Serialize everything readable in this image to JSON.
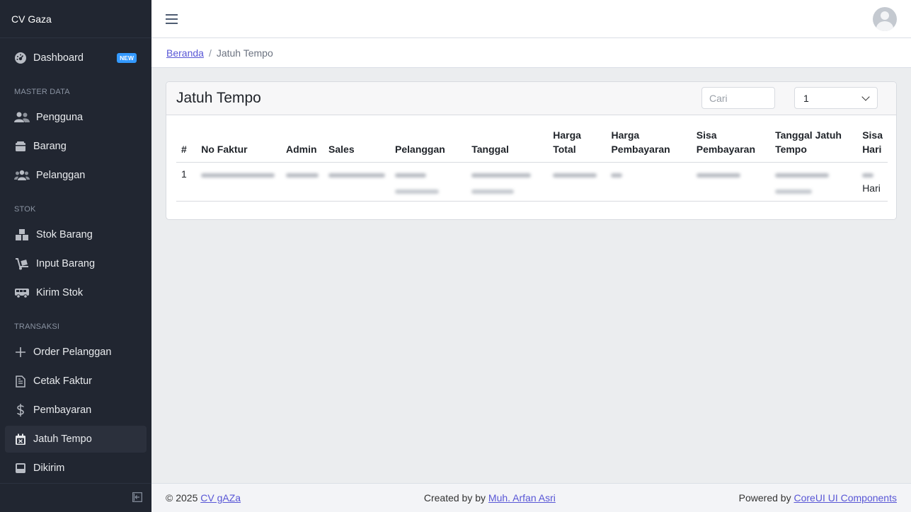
{
  "brand": "CV Gaza",
  "sidebar": {
    "dashboard": {
      "label": "Dashboard",
      "badge": "NEW"
    },
    "sections": {
      "master": "MASTER DATA",
      "stok": "STOK",
      "transaksi": "TRANSAKSI"
    },
    "items": {
      "pengguna": "Pengguna",
      "barang": "Barang",
      "pelanggan": "Pelanggan",
      "stok_barang": "Stok Barang",
      "input_barang": "Input Barang",
      "kirim_stok": "Kirim Stok",
      "order_pelanggan": "Order Pelanggan",
      "cetak_faktur": "Cetak Faktur",
      "pembayaran": "Pembayaran",
      "jatuh_tempo": "Jatuh Tempo",
      "dikirim": "Dikirim"
    }
  },
  "breadcrumb": {
    "home": "Beranda",
    "sep": "/",
    "current": "Jatuh Tempo"
  },
  "card": {
    "title": "Jatuh Tempo",
    "search_placeholder": "Cari",
    "select_value": "1"
  },
  "table": {
    "headers": {
      "num": "#",
      "no_faktur": "No Faktur",
      "admin": "Admin",
      "sales": "Sales",
      "pelanggan": "Pelanggan",
      "tanggal": "Tanggal",
      "harga_total": "Harga Total",
      "harga_pembayaran": "Harga Pembayaran",
      "sisa_pembayaran": "Sisa Pembayaran",
      "tanggal_jatuh_tempo": "Tanggal Jatuh Tempo",
      "sisa_hari": "Sisa Hari"
    },
    "row": {
      "num": "1",
      "sisa_hari_suffix": "Hari"
    }
  },
  "footer": {
    "copyright": "© 2025",
    "copyright_link": "CV gAZa",
    "created_prefix": "Created by by",
    "created_link": "Muh. Arfan Asri",
    "powered_prefix": "Powered by",
    "powered_link": "CoreUI UI Components"
  }
}
